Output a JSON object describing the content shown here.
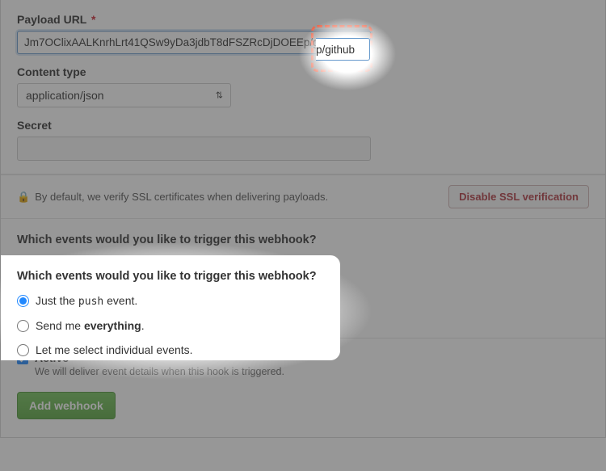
{
  "payload": {
    "label": "Payload URL",
    "required_marker": "*",
    "value": "Jm7OClixAALKnrhLrt41QSw9yDa3jdbT8dFSZRcDjDOEEp/github"
  },
  "content_type": {
    "label": "Content type",
    "selected": "application/json"
  },
  "secret": {
    "label": "Secret",
    "value": ""
  },
  "ssl": {
    "text": "By default, we verify SSL certificates when delivering payloads.",
    "disable_label": "Disable SSL verification"
  },
  "events": {
    "heading": "Which events would you like to trigger this webhook?",
    "options": {
      "push_prefix": "Just the ",
      "push_code": "push",
      "push_suffix": " event.",
      "everything_prefix": "Send me ",
      "everything_bold": "everything",
      "everything_suffix": ".",
      "individual": "Let me select individual events."
    }
  },
  "active": {
    "title": "Active",
    "desc": "We will deliver event details when this hook is triggered."
  },
  "submit": {
    "label": "Add webhook"
  }
}
